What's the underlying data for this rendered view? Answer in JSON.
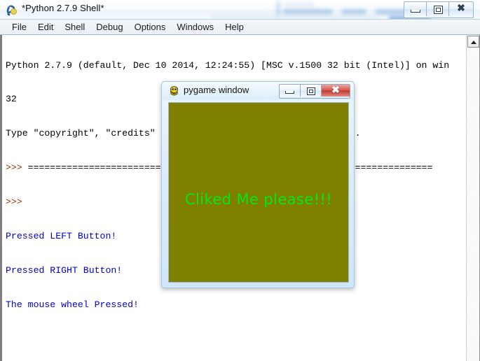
{
  "window": {
    "title": "*Python 2.7.9 Shell*",
    "icon": "python-idle-icon",
    "caption_buttons": [
      {
        "name": "minimize",
        "label": "–"
      },
      {
        "name": "maximize",
        "label": "□"
      },
      {
        "name": "close",
        "label": "✕"
      }
    ]
  },
  "menu": {
    "items": [
      {
        "label": "File"
      },
      {
        "label": "Edit"
      },
      {
        "label": "Shell"
      },
      {
        "label": "Debug"
      },
      {
        "label": "Options"
      },
      {
        "label": "Windows"
      },
      {
        "label": "Help"
      }
    ]
  },
  "shell": {
    "lines": [
      {
        "kind": "black",
        "text": "Python 2.7.9 (default, Dec 10 2014, 12:24:55) [MSC v.1500 32 bit (Intel)] on win"
      },
      {
        "kind": "black",
        "text": "32"
      },
      {
        "kind": "black",
        "text": "Type \"copyright\", \"credits\" or \"license()\" for more information."
      },
      {
        "kind": "restart",
        "prompt": ">>> ",
        "text": "================================ RESTART ================================"
      },
      {
        "kind": "prompt",
        "text": ">>> "
      },
      {
        "kind": "blue",
        "text": "Pressed LEFT Button!"
      },
      {
        "kind": "blue",
        "text": "Pressed RIGHT Button!"
      },
      {
        "kind": "blue",
        "text": "The mouse wheel Pressed!"
      }
    ]
  },
  "scrollbar": {
    "up_arrow": "scroll-up-arrow"
  },
  "pygame_window": {
    "title": "pygame window",
    "icon": "pygame-mascot-icon",
    "caption_buttons": [
      {
        "name": "minimize",
        "label": "–"
      },
      {
        "name": "maximize",
        "label": "□"
      },
      {
        "name": "close",
        "label": "✕"
      }
    ],
    "canvas": {
      "background_color": "#7f8000",
      "text": "Cliked Me please!!!",
      "text_color": "#00e81a"
    }
  }
}
